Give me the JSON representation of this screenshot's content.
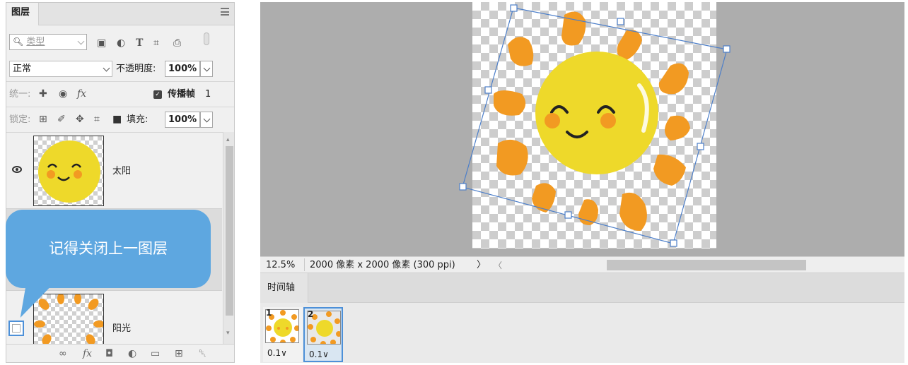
{
  "layers_panel": {
    "tab_label": "图层",
    "filter": {
      "label": "类型"
    },
    "blend_mode": "正常",
    "opacity_label": "不透明度:",
    "opacity_value": "100%",
    "unify_label": "统一:",
    "propagate_label": "传播帧",
    "propagate_value": "1",
    "lock_label": "锁定:",
    "fill_label": "填充:",
    "fill_value": "100%",
    "layers": [
      {
        "name": "太阳",
        "visible": true
      },
      {
        "name": "阳光",
        "visible": false
      }
    ]
  },
  "callout": {
    "text": "记得关闭上一图层",
    "color": "#5ea7e0"
  },
  "document": {
    "zoom": "12.5%",
    "info": "2000 像素 x 2000 像素 (300 ppi)",
    "info_arrow": "〉",
    "scroll_left": "〈"
  },
  "timeline": {
    "tab_label": "时间轴",
    "frames": [
      {
        "number": "1",
        "delay": "0.1",
        "selected": false
      },
      {
        "number": "2",
        "delay": "0.1",
        "selected": true
      }
    ]
  },
  "colors": {
    "sun_yellow": "#eed92a",
    "ray_orange": "#f29a22",
    "selection_blue": "#4d7fc9",
    "callout_blue": "#5ea7e0"
  },
  "icons": [
    "search-icon",
    "image-filter-icon",
    "adjustment-filter-icon",
    "type-filter-icon",
    "shape-filter-icon",
    "smart-object-filter-icon",
    "filter-toggle-icon",
    "panel-menu-icon",
    "eye-icon",
    "link-icon",
    "fx-icon",
    "mask-icon",
    "new-adjustment-icon",
    "folder-icon",
    "new-layer-icon",
    "trash-icon"
  ]
}
